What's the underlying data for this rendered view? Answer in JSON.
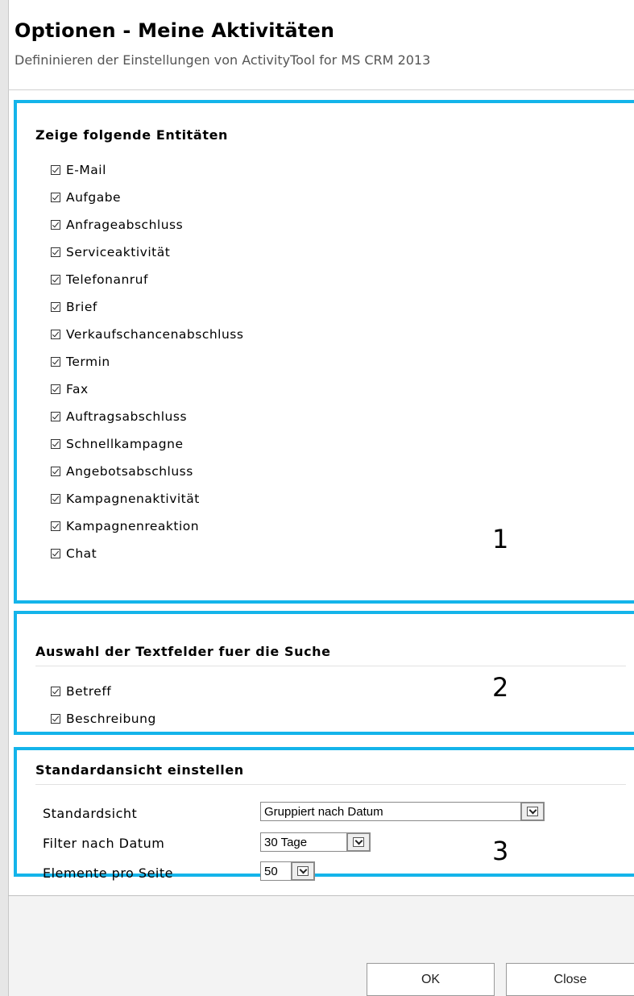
{
  "dialog": {
    "title": "Optionen - Meine Aktivitäten",
    "subtitle": "Defininieren der Einstellungen von ActivityTool for MS CRM 2013"
  },
  "section1": {
    "heading": "Zeige folgende Entitäten",
    "marker": "1",
    "items": [
      {
        "label": "E-Mail",
        "checked": true
      },
      {
        "label": "Aufgabe",
        "checked": true
      },
      {
        "label": "Anfrageabschluss",
        "checked": true
      },
      {
        "label": "Serviceaktivität",
        "checked": true
      },
      {
        "label": "Telefonanruf",
        "checked": true
      },
      {
        "label": "Brief",
        "checked": true
      },
      {
        "label": "Verkaufschancenabschluss",
        "checked": true
      },
      {
        "label": "Termin",
        "checked": true
      },
      {
        "label": "Fax",
        "checked": true
      },
      {
        "label": "Auftragsabschluss",
        "checked": true
      },
      {
        "label": "Schnellkampagne",
        "checked": true
      },
      {
        "label": "Angebotsabschluss",
        "checked": true
      },
      {
        "label": "Kampagnenaktivität",
        "checked": true
      },
      {
        "label": "Kampagnenreaktion",
        "checked": true
      },
      {
        "label": "Chat",
        "checked": true
      }
    ]
  },
  "section2": {
    "heading": "Auswahl der Textfelder fuer die Suche",
    "marker": "2",
    "items": [
      {
        "label": "Betreff",
        "checked": true
      },
      {
        "label": "Beschreibung",
        "checked": true
      }
    ]
  },
  "section3": {
    "heading": "Standardansicht einstellen",
    "marker": "3",
    "standardsicht_label": "Standardsicht",
    "standardsicht_value": "Gruppiert nach Datum",
    "filter_label": "Filter nach Datum",
    "filter_value": "30 Tage",
    "elemente_label": "Elemente pro Seite",
    "elemente_value": "50"
  },
  "footer": {
    "ok_label": "OK",
    "close_label": "Close"
  },
  "colors": {
    "section_border": "#14b4ea"
  }
}
